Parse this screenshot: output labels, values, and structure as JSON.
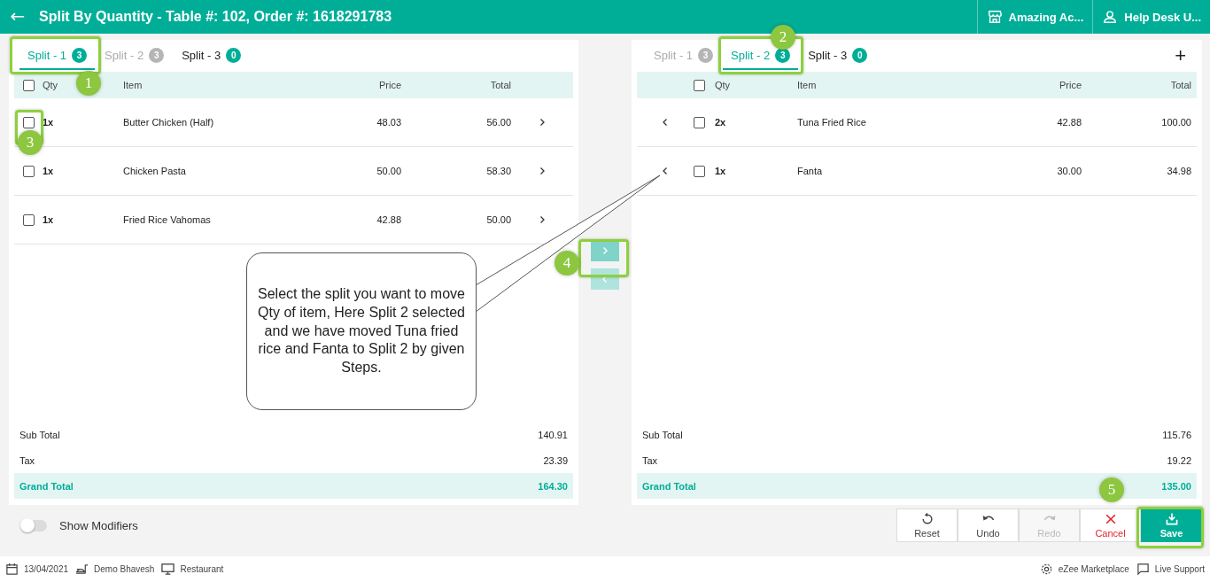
{
  "header": {
    "back": "←",
    "title": "Split By Quantity - Table #: 102, Order #: 1618291783",
    "menus": [
      {
        "kind": "store",
        "label": "Amazing Ac..."
      },
      {
        "kind": "user",
        "label": "Help Desk U..."
      }
    ]
  },
  "panels": [
    {
      "kind": "source",
      "tabs": [
        {
          "label": "Split - 1",
          "count": "3",
          "selected": true,
          "disabled": false
        },
        {
          "label": "Split - 2",
          "count": "3",
          "selected": false,
          "disabled": true
        },
        {
          "label": "Split - 3",
          "count": "0",
          "selected": false,
          "disabled": false
        }
      ],
      "columns": [
        "Qty",
        "Item",
        "Price",
        "Total"
      ],
      "select_all": false,
      "rows": [
        {
          "qty": "1x",
          "item": "Butter Chicken (Half)",
          "price": "48.03",
          "total": "56.00",
          "checked": false
        },
        {
          "qty": "1x",
          "item": "Chicken Pasta",
          "price": "50.00",
          "total": "58.30",
          "checked": false
        },
        {
          "qty": "1x",
          "item": "Fried Rice Vahomas",
          "price": "42.88",
          "total": "50.00",
          "checked": false
        }
      ],
      "totals": [
        {
          "label": "Sub Total",
          "value": "140.91",
          "grand": false
        },
        {
          "label": "Tax",
          "value": "23.39",
          "grand": false
        },
        {
          "label": "Grand Total",
          "value": "164.30",
          "grand": true
        }
      ]
    },
    {
      "kind": "target",
      "add": "+",
      "tabs": [
        {
          "label": "Split - 1",
          "count": "3",
          "selected": false,
          "disabled": true
        },
        {
          "label": "Split - 2",
          "count": "3",
          "selected": true,
          "disabled": false
        },
        {
          "label": "Split - 3",
          "count": "0",
          "selected": false,
          "disabled": false
        }
      ],
      "columns": [
        "Qty",
        "Item",
        "Price",
        "Total"
      ],
      "select_all": false,
      "rows": [
        {
          "qty": "2x",
          "item": "Tuna Fried Rice",
          "price": "42.88",
          "total": "100.00",
          "checked": false
        },
        {
          "qty": "1x",
          "item": "Fanta",
          "price": "30.00",
          "total": "34.98",
          "checked": false
        }
      ],
      "totals": [
        {
          "label": "Sub Total",
          "value": "115.76",
          "grand": false
        },
        {
          "label": "Tax",
          "value": "19.22",
          "grand": false
        },
        {
          "label": "Grand Total",
          "value": "135.00",
          "grand": true
        }
      ]
    }
  ],
  "show_modifiers": {
    "label": "Show Modifiers",
    "on": false
  },
  "actions": [
    {
      "kind": "reset",
      "label": "Reset"
    },
    {
      "kind": "undo",
      "label": "Undo"
    },
    {
      "kind": "redo",
      "label": "Redo",
      "disabled": true
    },
    {
      "kind": "cancel",
      "label": "Cancel"
    },
    {
      "kind": "save",
      "label": "Save"
    }
  ],
  "callout": "Select the split you want to move Qty of item, Here Split 2 selected and we have moved Tuna fried rice and Fanta to Split 2 by given Steps.",
  "steps": [
    {
      "number": "1"
    },
    {
      "number": "2"
    },
    {
      "number": "3"
    },
    {
      "number": "4"
    },
    {
      "number": "5"
    }
  ],
  "footer": {
    "left": [
      {
        "kind": "date",
        "text": "13/04/2021"
      },
      {
        "kind": "waiter",
        "text": "Demo Bhavesh"
      },
      {
        "kind": "terminal",
        "text": "Restaurant"
      }
    ],
    "right": [
      {
        "kind": "marketplace",
        "text": "eZee Marketplace"
      },
      {
        "kind": "support",
        "text": "Live Support"
      }
    ]
  }
}
